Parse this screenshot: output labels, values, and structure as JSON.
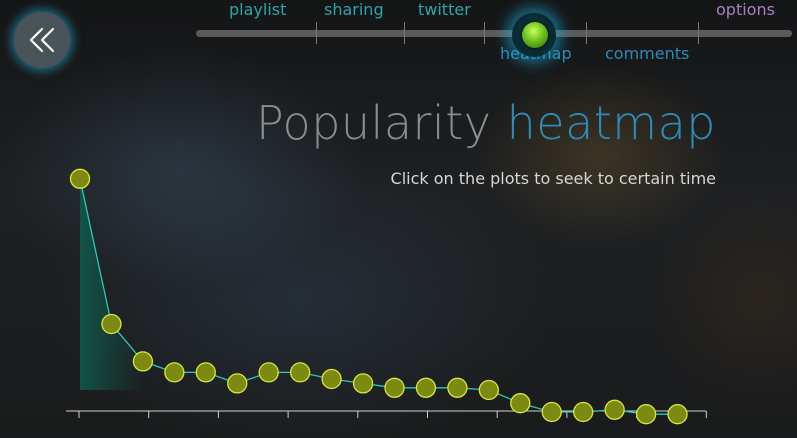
{
  "nav": {
    "back_icon": "double-chevron-left-icon",
    "tabs_top": [
      {
        "id": "playlist",
        "label": "playlist",
        "active": false
      },
      {
        "id": "sharing",
        "label": "sharing",
        "active": false
      },
      {
        "id": "twitter",
        "label": "twitter",
        "active": false
      },
      {
        "id": "options",
        "label": "options",
        "active": false
      }
    ],
    "tabs_bottom": [
      {
        "id": "heatmap",
        "label": "heatmap",
        "active": true
      },
      {
        "id": "comments",
        "label": "comments",
        "active": false
      }
    ]
  },
  "header": {
    "title_part1": "Popularity",
    "title_part2": "heatmap",
    "subtitle": "Click on the plots to seek to certain time"
  },
  "colors": {
    "tab_text": "#2aa5a8",
    "tab_active": "#2e8bb8",
    "options_text": "#a87fc0",
    "title_grey": "#8a8d8f",
    "title_blue": "#2e8bb8",
    "plot_fill": "#7d8a12",
    "plot_stroke": "#d6e83a",
    "line": "#2ec7b8",
    "area": "#0f5a4a"
  },
  "chart_data": {
    "type": "line",
    "values": [
      96,
      30,
      13,
      8,
      8,
      3,
      8,
      8,
      5,
      3,
      1,
      1,
      1,
      0,
      -6,
      -10,
      -10,
      -9,
      -11,
      -11
    ]
  }
}
